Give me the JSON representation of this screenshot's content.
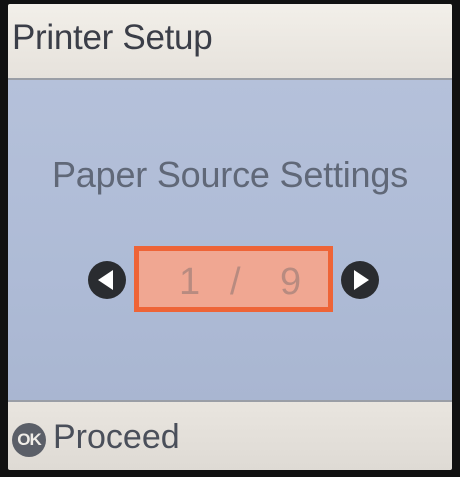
{
  "header": {
    "title": "Printer Setup"
  },
  "main": {
    "heading": "Paper Source Settings",
    "pager": {
      "current": "1",
      "separator": "/",
      "total": "9"
    },
    "prev_icon": "left-arrow-circle-icon",
    "next_icon": "right-arrow-circle-icon"
  },
  "footer": {
    "ok_icon_text": "OK",
    "action_label": "Proceed"
  },
  "colors": {
    "header_bg": "#eeeae4",
    "main_bg": "#b0bdd7",
    "counter_bg": "#f0a792",
    "counter_border": "#ee6437",
    "arrow": "#2a2c30"
  }
}
